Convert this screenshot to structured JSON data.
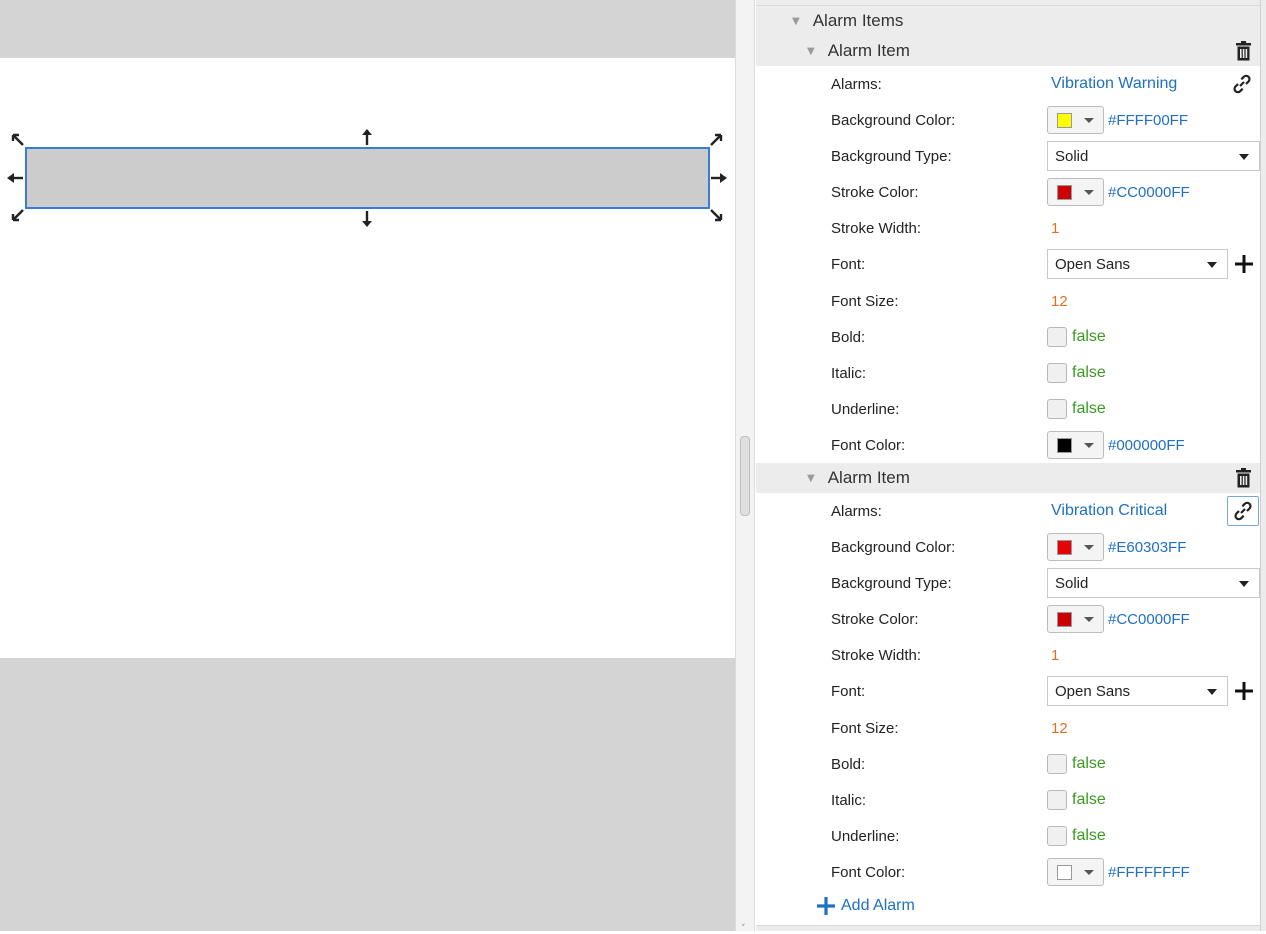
{
  "canvas": {
    "shape": {
      "fill": "#cccccc",
      "border": "#3a7bd5"
    }
  },
  "panel": {
    "section_title": "Alarm Items",
    "add_alarm_label": "Add Alarm",
    "items": [
      {
        "title": "Alarm Item",
        "alarms_label": "Alarms:",
        "alarms_value": "Vibration Warning",
        "bg_color_label": "Background Color:",
        "bg_color_hex": "#FFFF00FF",
        "bg_color_swatch": "#ffff00",
        "bg_type_label": "Background Type:",
        "bg_type_value": "Solid",
        "stroke_color_label": "Stroke Color:",
        "stroke_color_hex": "#CC0000FF",
        "stroke_color_swatch": "#cc0000",
        "stroke_width_label": "Stroke Width:",
        "stroke_width_value": "1",
        "font_label": "Font:",
        "font_value": "Open Sans",
        "font_size_label": "Font Size:",
        "font_size_value": "12",
        "bold_label": "Bold:",
        "bold_value": "false",
        "italic_label": "Italic:",
        "italic_value": "false",
        "underline_label": "Underline:",
        "underline_value": "false",
        "font_color_label": "Font Color:",
        "font_color_hex": "#000000FF",
        "font_color_swatch": "#000000"
      },
      {
        "title": "Alarm Item",
        "alarms_label": "Alarms:",
        "alarms_value": "Vibration Critical",
        "bg_color_label": "Background Color:",
        "bg_color_hex": "#E60303FF",
        "bg_color_swatch": "#e60303",
        "bg_type_label": "Background Type:",
        "bg_type_value": "Solid",
        "stroke_color_label": "Stroke Color:",
        "stroke_color_hex": "#CC0000FF",
        "stroke_color_swatch": "#cc0000",
        "stroke_width_label": "Stroke Width:",
        "stroke_width_value": "1",
        "font_label": "Font:",
        "font_value": "Open Sans",
        "font_size_label": "Font Size:",
        "font_size_value": "12",
        "bold_label": "Bold:",
        "bold_value": "false",
        "italic_label": "Italic:",
        "italic_value": "false",
        "underline_label": "Underline:",
        "underline_value": "false",
        "font_color_label": "Font Color:",
        "font_color_hex": "#FFFFFFFF",
        "font_color_swatch": "#ffffff"
      }
    ]
  }
}
